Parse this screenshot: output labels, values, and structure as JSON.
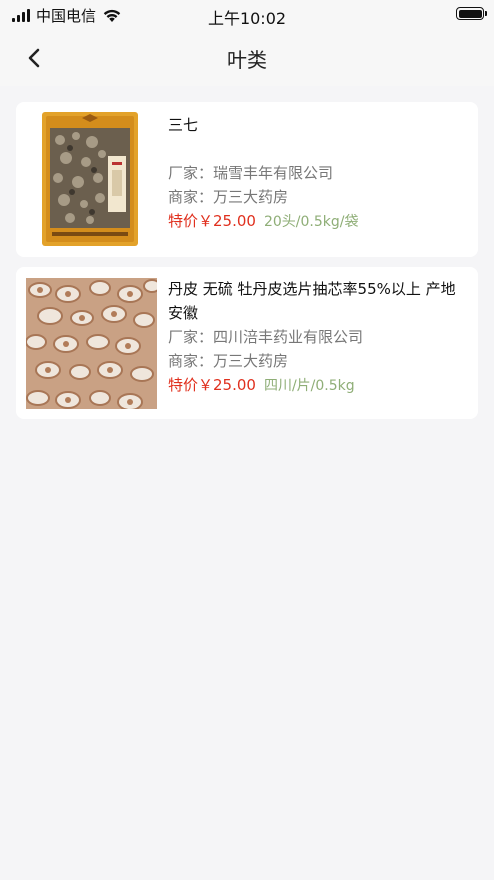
{
  "status_bar": {
    "carrier": "中国电信",
    "time": "上午10:02"
  },
  "nav": {
    "title": "叶类",
    "back_icon": "chevron-left-icon"
  },
  "products": [
    {
      "name": "三七",
      "manufacturer_label": "厂家：",
      "manufacturer": "瑞雪丰年有限公司",
      "merchant_label": "商家：",
      "merchant": "万三大药房",
      "price_label": "特价￥25.00",
      "spec": "20头/0.5kg/袋"
    },
    {
      "name": "丹皮 无硫 牡丹皮选片抽芯率55%以上 产地 安徽",
      "manufacturer_label": "厂家：",
      "manufacturer": "四川涪丰药业有限公司",
      "merchant_label": "商家：",
      "merchant": "万三大药房",
      "price_label": "特价￥25.00",
      "spec": "四川/片/0.5kg"
    }
  ]
}
